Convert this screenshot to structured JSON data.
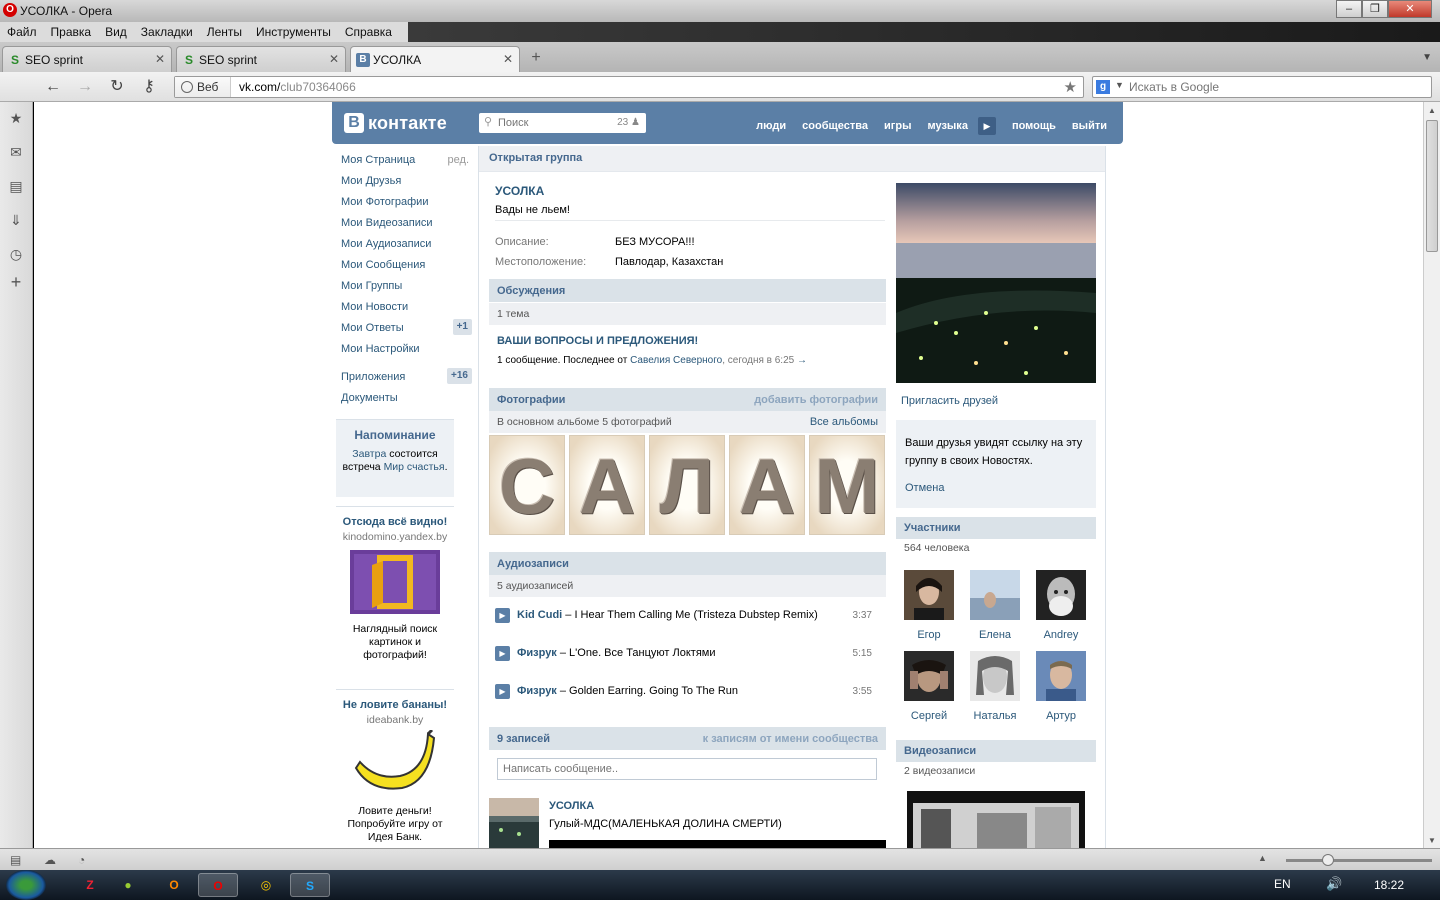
{
  "window": {
    "title": "УСОЛКА - Opera",
    "menu": [
      "Файл",
      "Правка",
      "Вид",
      "Закладки",
      "Ленты",
      "Инструменты",
      "Справка"
    ]
  },
  "tabs": [
    {
      "label": "SEO sprint"
    },
    {
      "label": "SEO sprint"
    },
    {
      "label": "УСОЛКА"
    }
  ],
  "address": {
    "mode_label": "Веб",
    "url_host": "vk.com/",
    "url_path": "club70364066",
    "search_placeholder": "Искать в Google"
  },
  "taskbar": {
    "lang": "EN",
    "clock": "18:22"
  },
  "vk": {
    "logo_text": "контакте",
    "search_placeholder": "Поиск",
    "search_count": "23",
    "nav": [
      "люди",
      "сообщества",
      "игры",
      "музыка",
      "помощь",
      "выйти"
    ],
    "left_menu": [
      {
        "label": "Моя Страница",
        "extra": "ред."
      },
      {
        "label": "Мои Друзья"
      },
      {
        "label": "Мои Фотографии"
      },
      {
        "label": "Мои Видеозаписи"
      },
      {
        "label": "Мои Аудиозаписи"
      },
      {
        "label": "Мои Сообщения"
      },
      {
        "label": "Мои Группы"
      },
      {
        "label": "Мои Новости"
      },
      {
        "label": "Мои Ответы",
        "badge": "+1"
      },
      {
        "label": "Мои Настройки"
      }
    ],
    "left_menu2": [
      {
        "label": "Приложения",
        "badge": "+16"
      },
      {
        "label": "Документы"
      }
    ],
    "reminder": {
      "title": "Напоминание",
      "tomorrow": "Завтра",
      "text1": " состоится встреча ",
      "link": "Мир счастья",
      "text2": "."
    },
    "ads": [
      {
        "title": "Отсюда всё видно!",
        "site": "kinodomino.yandex.by",
        "desc": "Наглядный поиск картинок и фотографий!"
      },
      {
        "title": "Не ловите бананы!",
        "site": "ideabank.by",
        "desc": "Ловите деньги! Попробуйте игру от Идея Банк."
      }
    ],
    "group": {
      "type": "Открытая группа",
      "name": "УСОЛКА",
      "status": "Вады не льем!",
      "info": [
        {
          "label": "Описание:",
          "value": "БЕЗ МУСОРА!!!"
        },
        {
          "label": "Местоположение:",
          "value": "Павлодар, Казахстан"
        }
      ]
    },
    "discussions": {
      "title": "Обсуждения",
      "count": "1 тема",
      "topic": "ВАШИ ВОПРОСЫ И ПРЕДЛОЖЕНИЯ!",
      "meta_prefix": "1 сообщение. Последнее от ",
      "meta_author": "Савелия Северного",
      "meta_time": ", сегодня в 6:25",
      "arrow": "→"
    },
    "photos": {
      "title": "Фотографии",
      "action": "добавить фотографии",
      "count": "В основном альбоме 5 фотографий",
      "all": "Все альбомы",
      "letters": [
        "С",
        "А",
        "Л",
        "А",
        "М"
      ]
    },
    "audio": {
      "title": "Аудиозаписи",
      "count": "5 аудиозаписей",
      "tracks": [
        {
          "artist": "Kid Cudi",
          "title": " – I Hear Them Calling Me (Tristeza Dubstep Remix)",
          "duration": "3:37"
        },
        {
          "artist": "Физрук",
          "title": " – L'One. Все Танцуют Локтями",
          "duration": "5:15"
        },
        {
          "artist": "Физрук",
          "title": " – Golden Earring. Going To The Run",
          "duration": "3:55"
        }
      ]
    },
    "wall": {
      "title": "9 записей",
      "action": "к записям от имени сообщества",
      "placeholder": "Написать сообщение..",
      "post_author": "УСОЛКА",
      "post_text": "Гулый-МДС(МАЛЕНЬКАЯ ДОЛИНА СМЕРТИ)"
    },
    "right": {
      "invite": "Пригласить друзей",
      "invite_note": "Ваши друзья увидят ссылку на эту группу в своих Новостях.",
      "cancel": "Отмена",
      "members_title": "Участники",
      "members_count": "564 человека",
      "members": [
        "Егор",
        "Елена",
        "Andrey",
        "Сергей",
        "Наталья",
        "Артур"
      ],
      "videos_title": "Видеозаписи",
      "videos_count": "2 видеозаписи"
    }
  }
}
